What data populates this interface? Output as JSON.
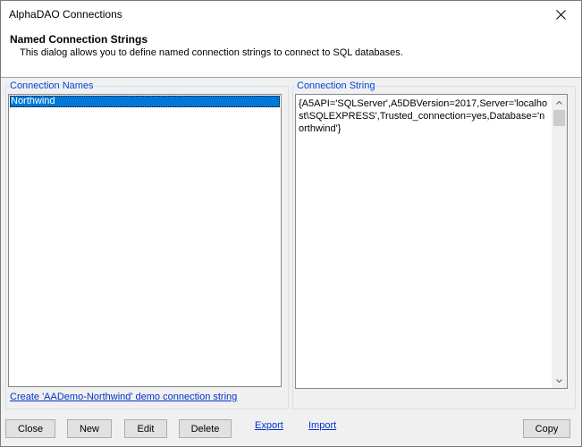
{
  "window": {
    "title": "AlphaDAO Connections"
  },
  "header": {
    "title": "Named Connection Strings",
    "description": "This dialog allows you to define named connection strings to connect to SQL databases."
  },
  "connection_names": {
    "legend": "Connection Names",
    "items": [
      {
        "label": "Northwind",
        "selected": true
      }
    ]
  },
  "connection_string": {
    "legend": "Connection String",
    "value": "{A5API='SQLServer',A5DBVersion=2017,Server='localhost\\SQLEXPRESS',Trusted_connection=yes,Database='northwind'}"
  },
  "demo_link": "Create 'AADemo-Northwind' demo connection string",
  "buttons": {
    "close": "Close",
    "new": "New",
    "edit": "Edit",
    "delete": "Delete",
    "export": "Export",
    "import": "Import",
    "copy": "Copy"
  },
  "icons": {
    "close": "close-icon",
    "scroll_up": "chevron-up-icon",
    "scroll_down": "chevron-down-icon"
  },
  "colors": {
    "selection": "#0078d7",
    "legend": "#0046d5",
    "link": "#0033cc"
  }
}
